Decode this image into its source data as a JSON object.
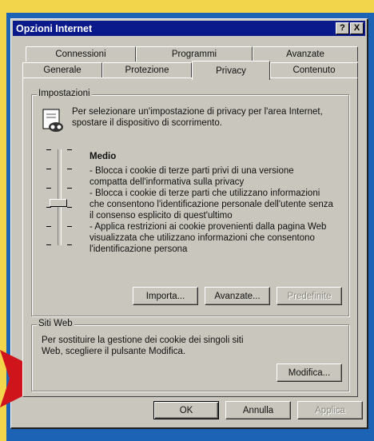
{
  "window": {
    "title": "Opzioni Internet"
  },
  "titlebar_buttons": {
    "help": "?",
    "close": "X"
  },
  "tabs_row1": [
    "Connessioni",
    "Programmi",
    "Avanzate"
  ],
  "tabs_row2": [
    "Generale",
    "Protezione",
    "Privacy",
    "Contenuto"
  ],
  "active_tab": "Privacy",
  "settings": {
    "legend": "Impostazioni",
    "intro_line1": "Per selezionare un'impostazione di privacy per l'area Internet,",
    "intro_line2": "spostare il dispositivo di scorrimento.",
    "level_title": "Medio",
    "desc_lines": [
      "- Blocca i cookie di terze parti privi di una versione",
      "compatta dell'informativa sulla privacy",
      "- Blocca i cookie di terze parti che utilizzano informazioni",
      "che consentono l'identificazione personale dell'utente senza",
      "il consenso esplicito di quest'ultimo",
      "- Applica restrizioni ai cookie provenienti dalla pagina Web",
      "visualizzata che utilizzano informazioni che consentono",
      "l'identificazione persona"
    ],
    "import_label": "Importa...",
    "advanced_label": "Avanzate...",
    "default_label": "Predefinite"
  },
  "websites": {
    "legend": "Siti Web",
    "line1": "Per sostituire la gestione dei cookie dei singoli siti",
    "line2": "Web, scegliere il pulsante Modifica.",
    "edit_label": "Modifica..."
  },
  "footer": {
    "ok_label": "OK",
    "cancel_label": "Annulla",
    "apply_label": "Applica"
  },
  "colors": {
    "title_bar": "#0a1a8a",
    "window_face": "#c9c6bd",
    "accent_arrow": "#d0141c",
    "frame_blue": "#1d63b5",
    "frame_yellow": "#f2d54a"
  }
}
